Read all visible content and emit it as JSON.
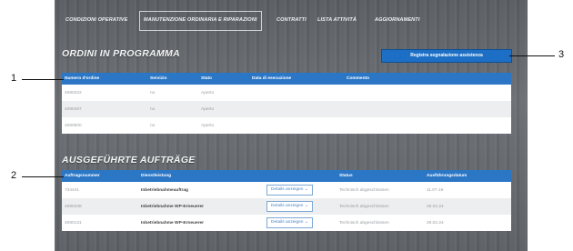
{
  "tabs": [
    {
      "label": "Condizioni operative"
    },
    {
      "label": "Manutenzione ordinaria e riparazioni"
    },
    {
      "label": "Contratti"
    },
    {
      "label": "Lista attività"
    },
    {
      "label": "Aggiornamenti"
    }
  ],
  "section1": {
    "title": "ORDINI IN PROGRAMMA",
    "action_button": "Registra segnalazione assistenza",
    "columns": [
      "Numero d'ordine",
      "Servizio",
      "Stato",
      "Data di esecuzione",
      "Commento"
    ],
    "rows": [
      [
        "4080322",
        "no",
        "Aperto",
        "",
        ""
      ],
      [
        "4080487",
        "no",
        "Aperto",
        "",
        ""
      ],
      [
        "4080500",
        "no",
        "Aperto",
        "",
        ""
      ]
    ]
  },
  "section2": {
    "title": "AUSGEFÜHRTE AUFTRÄGE",
    "columns": [
      "Auftragsnummer",
      "Dienstleistung",
      "",
      "Status",
      "Ausführungsdatum"
    ],
    "details_label": "Details anzeigen",
    "rows": [
      [
        "734441",
        "Inbetriebnahmeauftrag",
        "Technisch abgeschlossen",
        "11.07.19"
      ],
      [
        "4080438",
        "Inbetriebnahme WP-Erneuerer",
        "Technisch abgeschlossen",
        "29.02.24"
      ],
      [
        "4080131",
        "Inbetriebnahme WP-Erneuerer",
        "Technisch abgeschlossen",
        "29.02.24"
      ]
    ]
  },
  "callouts": [
    "1",
    "2",
    "3"
  ]
}
